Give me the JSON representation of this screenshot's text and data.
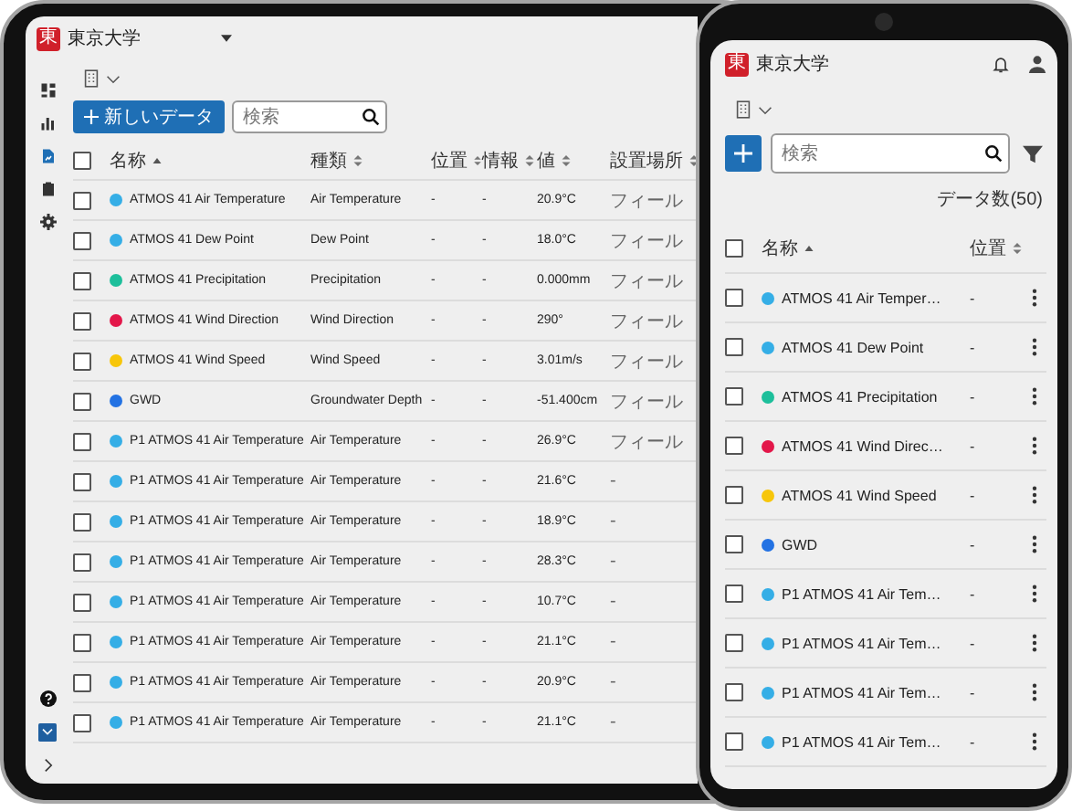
{
  "tablet": {
    "logo": "東",
    "org": "東京大学",
    "sidebar": [
      {
        "kind": "dashboard",
        "selected": false
      },
      {
        "kind": "chart",
        "selected": false
      },
      {
        "kind": "document",
        "selected": true
      },
      {
        "kind": "clipboard",
        "selected": false
      },
      {
        "kind": "settings",
        "selected": false
      }
    ],
    "new_button": "新しいデータ",
    "search": {
      "placeholder": "検索"
    },
    "header_checked": false,
    "columns": [
      {
        "label": "名称",
        "sorted": true
      },
      {
        "label": "種類",
        "sorted": false
      },
      {
        "label": "位置",
        "sorted": false
      },
      {
        "label": "情報",
        "sorted": false
      },
      {
        "label": "値",
        "sorted": false
      },
      {
        "label": "設置場所",
        "sorted": false
      }
    ],
    "rows": [
      {
        "name": "ATMOS 41 Air Temperature",
        "color": "#35aee6",
        "type": "Air Temperature",
        "location": "-",
        "info": "-",
        "value": "20.9°C",
        "site": "フィール",
        "checked": false
      },
      {
        "name": "ATMOS 41 Dew Point",
        "color": "#35aee6",
        "type": "Dew Point",
        "location": "-",
        "info": "-",
        "value": "18.0°C",
        "site": "フィール",
        "checked": false
      },
      {
        "name": "ATMOS 41 Precipitation",
        "color": "#1dbf9b",
        "type": "Precipitation",
        "location": "-",
        "info": "-",
        "value": "0.000mm",
        "site": "フィール",
        "checked": false
      },
      {
        "name": "ATMOS 41 Wind Direction",
        "color": "#e3174a",
        "type": "Wind Direction",
        "location": "-",
        "info": "-",
        "value": "290°",
        "site": "フィール",
        "checked": false
      },
      {
        "name": "ATMOS 41 Wind Speed",
        "color": "#f7c60a",
        "type": "Wind Speed",
        "location": "-",
        "info": "-",
        "value": "3.01m/s",
        "site": "フィール",
        "checked": false
      },
      {
        "name": "GWD",
        "color": "#2372e3",
        "type": "Groundwater Depth",
        "location": "-",
        "info": "-",
        "value": "-51.400cm",
        "site": "フィール",
        "checked": false
      },
      {
        "name": "P1 ATMOS 41 Air Temperature",
        "color": "#35aee6",
        "type": "Air Temperature",
        "location": "-",
        "info": "-",
        "value": "26.9°C",
        "site": "フィール",
        "checked": false
      },
      {
        "name": "P1 ATMOS 41 Air Temperature",
        "color": "#35aee6",
        "type": "Air Temperature",
        "location": "-",
        "info": "-",
        "value": "21.6°C",
        "site": "-",
        "checked": false
      },
      {
        "name": "P1 ATMOS 41 Air Temperature",
        "color": "#35aee6",
        "type": "Air Temperature",
        "location": "-",
        "info": "-",
        "value": "18.9°C",
        "site": "-",
        "checked": false
      },
      {
        "name": "P1 ATMOS 41 Air Temperature",
        "color": "#35aee6",
        "type": "Air Temperature",
        "location": "-",
        "info": "-",
        "value": "28.3°C",
        "site": "-",
        "checked": false
      },
      {
        "name": "P1 ATMOS 41 Air Temperature",
        "color": "#35aee6",
        "type": "Air Temperature",
        "location": "-",
        "info": "-",
        "value": "10.7°C",
        "site": "-",
        "checked": false
      },
      {
        "name": "P1 ATMOS 41 Air Temperature",
        "color": "#35aee6",
        "type": "Air Temperature",
        "location": "-",
        "info": "-",
        "value": "21.1°C",
        "site": "-",
        "checked": false
      },
      {
        "name": "P1 ATMOS 41 Air Temperature",
        "color": "#35aee6",
        "type": "Air Temperature",
        "location": "-",
        "info": "-",
        "value": "20.9°C",
        "site": "-",
        "checked": false
      },
      {
        "name": "P1 ATMOS 41 Air Temperature",
        "color": "#35aee6",
        "type": "Air Temperature",
        "location": "-",
        "info": "-",
        "value": "21.1°C",
        "site": "-",
        "checked": false
      }
    ]
  },
  "phone": {
    "logo": "東",
    "org": "東京大学",
    "search": {
      "placeholder": "検索"
    },
    "count": "データ数(50)",
    "header_checked": false,
    "columns": [
      {
        "label": "名称",
        "sorted": true
      },
      {
        "label": "位置",
        "sorted": false
      }
    ],
    "rows": [
      {
        "name": "ATMOS 41 Air Temper…",
        "color": "#35aee6",
        "location": "-",
        "checked": false
      },
      {
        "name": "ATMOS 41 Dew Point",
        "color": "#35aee6",
        "location": "-",
        "checked": false
      },
      {
        "name": "ATMOS 41 Precipitation",
        "color": "#1dbf9b",
        "location": "-",
        "checked": false
      },
      {
        "name": "ATMOS 41 Wind Direc…",
        "color": "#e3174a",
        "location": "-",
        "checked": false
      },
      {
        "name": "ATMOS 41 Wind Speed",
        "color": "#f7c60a",
        "location": "-",
        "checked": false
      },
      {
        "name": "GWD",
        "color": "#2372e3",
        "location": "-",
        "checked": false
      },
      {
        "name": "P1 ATMOS 41 Air Tem…",
        "color": "#35aee6",
        "location": "-",
        "checked": false
      },
      {
        "name": "P1 ATMOS 41 Air Tem…",
        "color": "#35aee6",
        "location": "-",
        "checked": false
      },
      {
        "name": "P1 ATMOS 41 Air Tem…",
        "color": "#35aee6",
        "location": "-",
        "checked": false
      },
      {
        "name": "P1 ATMOS 41 Air Tem…",
        "color": "#35aee6",
        "location": "-",
        "checked": false
      }
    ]
  }
}
